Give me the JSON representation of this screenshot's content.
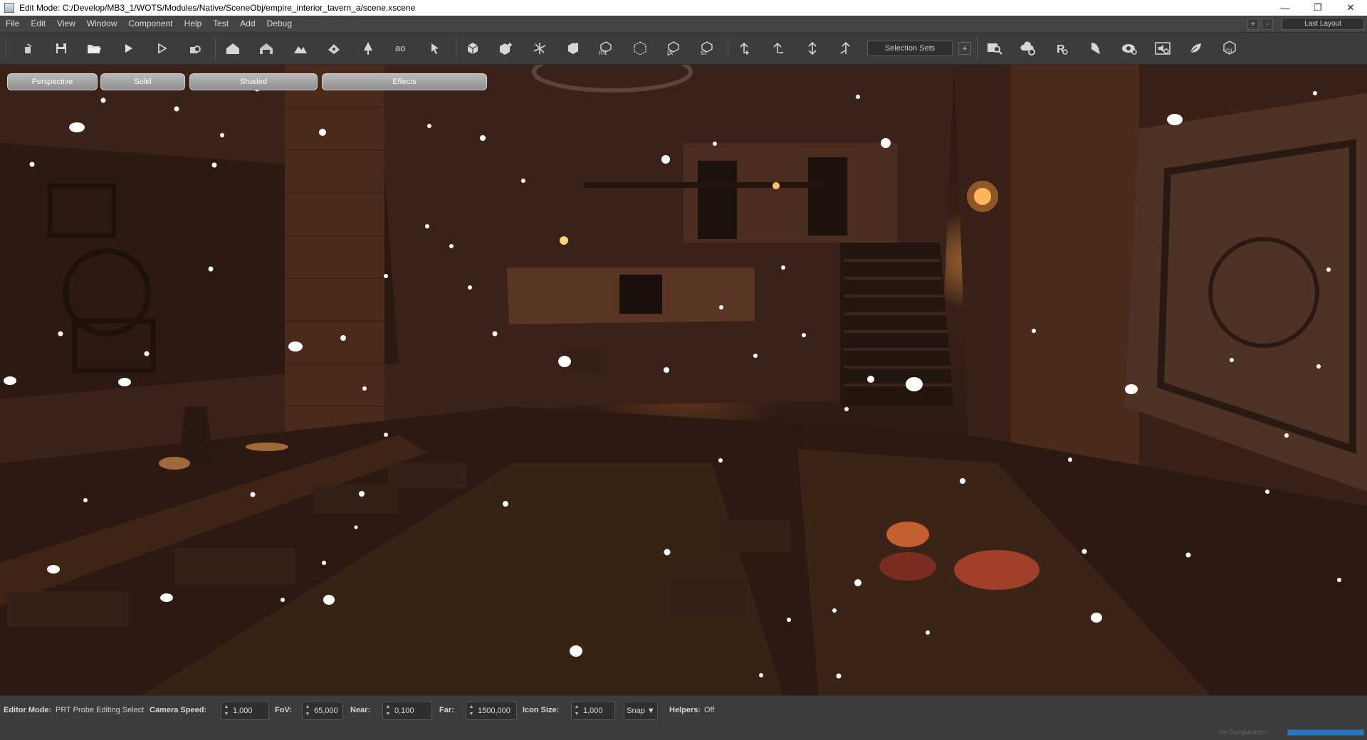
{
  "window": {
    "title": "Edit Mode: C:/Develop/MB3_1/WOTS/Modules/Native/SceneObj/empire_interior_tavern_a/scene.xscene",
    "minimize_glyph": "—",
    "restore_glyph": "❐",
    "close_glyph": "✕"
  },
  "menu": {
    "items": [
      "File",
      "Edit",
      "View",
      "Window",
      "Component",
      "Help",
      "Test",
      "Add",
      "Debug"
    ],
    "add_glyph": "+",
    "remove_glyph": "-",
    "layout_label": "Last Layout"
  },
  "toolbar": {
    "selection_sets_label": "Selection Sets",
    "selection_sets_add": "+",
    "icons": [
      "new-scene-icon",
      "save-icon",
      "open-folder-icon",
      "play-icon",
      "play-outline-icon",
      "build-icon",
      "house-icon",
      "house-outline-icon",
      "terrain-icon",
      "paint-icon",
      "tree-icon",
      "ao-icon",
      "cursor-icon",
      "cube-select-icon",
      "cube-add-icon",
      "axis-icon",
      "box-move-icon",
      "mt-icon",
      "cube-wire-icon",
      "pt-icon",
      "st-icon",
      "flora-add-icon",
      "flora-remove-icon",
      "flora-edit-icon",
      "flora-paint-icon",
      "search-icon",
      "weather-icon",
      "r-icon",
      "flag-icon",
      "eye-icon",
      "sound-icon",
      "foliage-icon",
      "gi-icon"
    ]
  },
  "viewport": {
    "perspective_label": "Perspective",
    "solid_label": "Solid",
    "shaded_label": "Shaded",
    "effects_label": "Effects"
  },
  "status": {
    "editor_mode_label": "Editor Mode:",
    "editor_mode_value": "PRT Probe Editing Select",
    "camera_speed_label": "Camera Speed:",
    "camera_speed_value": "1,000",
    "fov_label": "FoV:",
    "fov_value": "65,000",
    "near_label": "Near:",
    "near_value": "0,100",
    "far_label": "Far:",
    "far_value": "1500,000",
    "icon_size_label": "Icon Size:",
    "icon_size_value": "1,000",
    "snap_label": "Snap ▼",
    "helpers_label": "Helpers:",
    "helpers_value": "Off",
    "computation_text": "No Computation",
    "progress": 1.0
  }
}
